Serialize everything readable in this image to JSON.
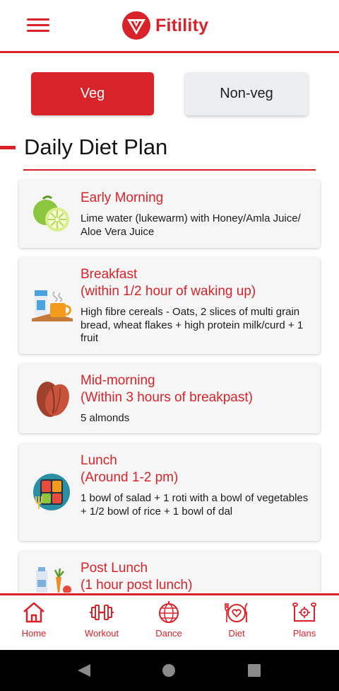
{
  "app": {
    "name": "Fitility",
    "brand_color": "#d8232a"
  },
  "header": {
    "menu_icon": "hamburger-menu-icon",
    "logo_icon": "fitility-logo-icon"
  },
  "diet_toggle": {
    "options": [
      {
        "label": "Veg",
        "selected": true
      },
      {
        "label": "Non-veg",
        "selected": false
      }
    ]
  },
  "section": {
    "title": "Daily Diet Plan"
  },
  "meals": [
    {
      "title": "Early Morning",
      "desc": "Lime water (lukewarm) with Honey/Amla Juice/ Aloe Vera Juice",
      "icon": "lime-icon"
    },
    {
      "title": "Breakfast\n(within 1/2 hour of waking up)",
      "desc": "High fibre cereals - Oats, 2 slices of multi grain bread, wheat flakes + high protein milk/curd + 1 fruit",
      "icon": "breakfast-icon"
    },
    {
      "title": "Mid-morning\n(Within 3 hours of breakpast)",
      "desc": "5 almonds",
      "icon": "almond-icon"
    },
    {
      "title": "Lunch\n(Around 1-2 pm)",
      "desc": "1 bowl of salad + 1 roti with a bowl of vegetables + 1/2 bowl of rice + 1 bowl of dal",
      "icon": "lunch-plate-icon"
    },
    {
      "title": "Post Lunch\n(1 hour post lunch)",
      "desc": "",
      "icon": "post-lunch-icon"
    }
  ],
  "bottom_nav": {
    "items": [
      {
        "label": "Home",
        "icon": "home-icon"
      },
      {
        "label": "Workout",
        "icon": "dumbbell-icon"
      },
      {
        "label": "Dance",
        "icon": "disco-ball-icon"
      },
      {
        "label": "Diet",
        "icon": "diet-plate-icon"
      },
      {
        "label": "Plans",
        "icon": "plans-icon"
      }
    ]
  },
  "system_nav": {
    "back": "back-icon",
    "home": "home-circle-icon",
    "recents": "recents-square-icon"
  }
}
